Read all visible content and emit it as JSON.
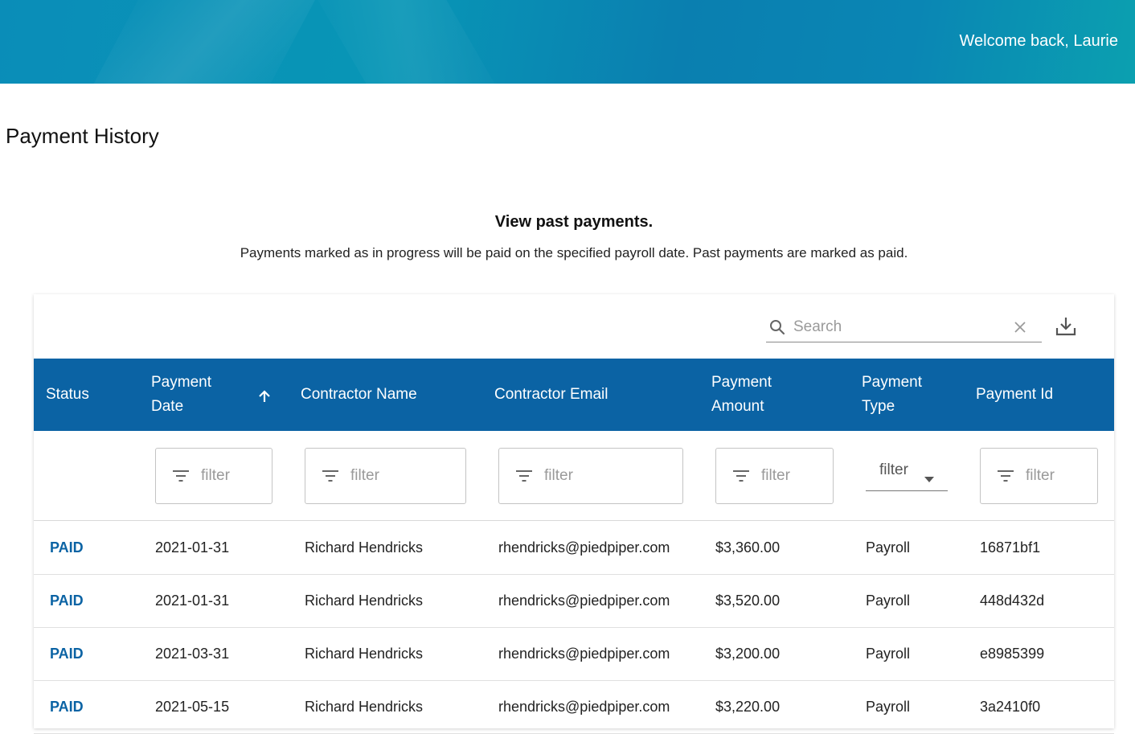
{
  "header": {
    "welcome": "Welcome back, Laurie"
  },
  "page": {
    "title": "Payment History",
    "intro_title": "View past payments.",
    "intro_text": "Payments marked as in progress will be paid on the specified payroll date. Past payments are marked as paid."
  },
  "toolbar": {
    "search_placeholder": "Search"
  },
  "colors": {
    "header_bg": "#0b63a4",
    "status_paid": "#0b63a4",
    "banner": "#0a8db8"
  },
  "table": {
    "columns": {
      "status": "Status",
      "payment_date_1": "Payment",
      "payment_date_2": "Date",
      "contractor_name": "Contractor Name",
      "contractor_email": "Contractor Email",
      "payment_amount_1": "Payment",
      "payment_amount_2": "Amount",
      "payment_type_1": "Payment",
      "payment_type_2": "Type",
      "payment_id": "Payment Id"
    },
    "sort": {
      "column": "Payment Date",
      "direction": "ascending"
    },
    "filter_placeholder": "filter",
    "rows": [
      {
        "status": "PAID",
        "date": "2021-01-31",
        "name": "Richard Hendricks",
        "email": "rhendricks@piedpiper.com",
        "amount": "$3,360.00",
        "type": "Payroll",
        "id": "16871bf1"
      },
      {
        "status": "PAID",
        "date": "2021-01-31",
        "name": "Richard Hendricks",
        "email": "rhendricks@piedpiper.com",
        "amount": "$3,520.00",
        "type": "Payroll",
        "id": "448d432d"
      },
      {
        "status": "PAID",
        "date": "2021-03-31",
        "name": "Richard Hendricks",
        "email": "rhendricks@piedpiper.com",
        "amount": "$3,200.00",
        "type": "Payroll",
        "id": "e8985399"
      },
      {
        "status": "PAID",
        "date": "2021-05-15",
        "name": "Richard Hendricks",
        "email": "rhendricks@piedpiper.com",
        "amount": "$3,220.00",
        "type": "Payroll",
        "id": "3a2410f0"
      }
    ]
  }
}
